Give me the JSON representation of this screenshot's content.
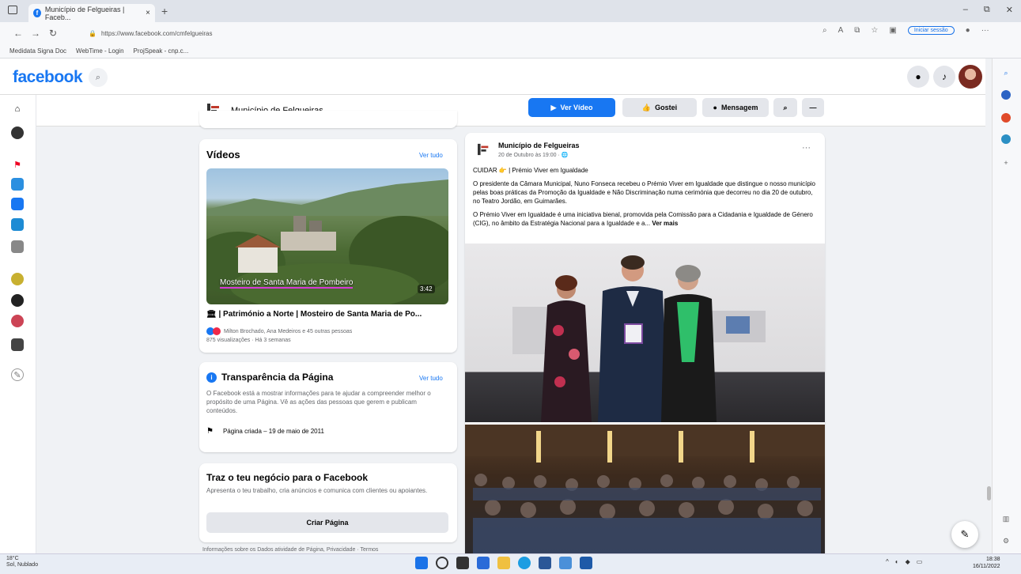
{
  "browser": {
    "tab_title": "Município de Felgueiras | Faceb...",
    "tab_close": "×",
    "new_tab": "+",
    "window_controls": [
      "–",
      "⧉",
      "✕"
    ],
    "url": "https://www.facebook.com/cmfelgueiras",
    "signin_label": "Iniciar sessão",
    "favorites": [
      "Medidata Signa Doc",
      "WebTime - Login",
      "ProjSpeak - cnp.c..."
    ]
  },
  "facebook": {
    "logo": "facebook"
  },
  "page_header": {
    "name": "Município de Felgueiras",
    "btn_video": "Ver Vídeo",
    "btn_like": "Gostei",
    "btn_message": "Mensagem"
  },
  "videos_card": {
    "title": "Vídeos",
    "see_all": "Ver tudo",
    "video_caption": "Mosteiro de Santa Maria de Pombeiro",
    "duration": "3:42",
    "description": "🏛 | Património a Norte | Mosteiro de Santa Maria de Po...",
    "reactions": "Milton Brochado, Ana Medeiros e 45 outras pessoas",
    "views": "875 visualizações · Há 3 semanas"
  },
  "transparency_card": {
    "title": "Transparência da Página",
    "see_all": "Ver tudo",
    "text": "O Facebook está a mostrar informações para te ajudar a compreender melhor o propósito de uma Página. Vê as ações das pessoas que gerem e publicam conteúdos.",
    "created": "Página criada – 19 de maio de 2011"
  },
  "business_card": {
    "title": "Traz o teu negócio para o Facebook",
    "text": "Apresenta o teu trabalho, cria anúncios e comunica com clientes ou apoiantes.",
    "button": "Criar Página",
    "below": "Informações sobre os Dados atividade de Página, Privacidade · Termos"
  },
  "post": {
    "author": "Município de Felgueiras",
    "date": "20 de Outubro às 19:00 · 🌐",
    "more": "···",
    "line1": "CUIDAR 👉 | Prémio Viver em Igualdade",
    "para1": "O presidente da Câmara Municipal, Nuno Fonseca recebeu o Prémio Viver em Igualdade que distingue o nosso município pelas boas práticas da Promoção da Igualdade e Não Discriminação numa cerimónia que decorreu no dia 20 de outubro, no Teatro Jordão, em Guimarães.",
    "para2": "O Prémio Viver em Igualdade é uma iniciativa bienal, promovida pela Comissão para a Cidadania e Igualdade de Género (CIG), no âmbito da Estratégia Nacional para a Igualdade e a...",
    "see_more": "Ver mais"
  },
  "taskbar": {
    "weather_temp": "18°C",
    "weather_desc": "Sol, Nublado",
    "time": "18:38",
    "date": "16/11/2022"
  },
  "colors": {
    "facebook_blue": "#1877f2",
    "background": "#f0f2f5"
  }
}
